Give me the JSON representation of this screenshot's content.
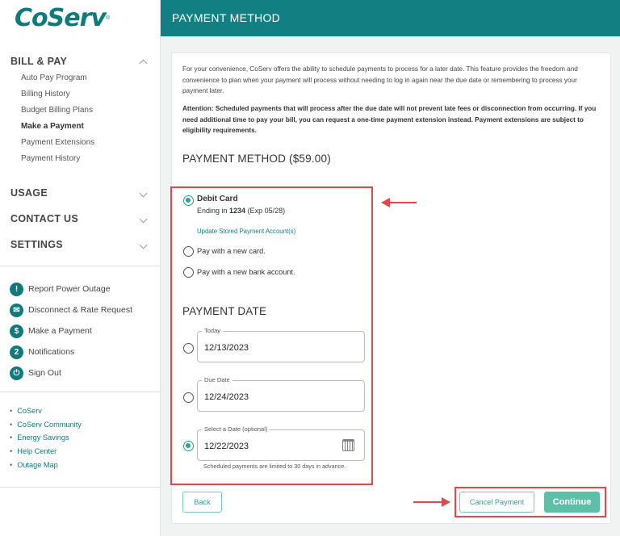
{
  "brand": {
    "logo_text": "CoServ",
    "logo_mark": "®"
  },
  "header": {
    "title": "PAYMENT METHOD"
  },
  "sidebar": {
    "bill_pay": {
      "label": "BILL & PAY",
      "items": [
        {
          "label": "Auto Pay Program"
        },
        {
          "label": "Billing History"
        },
        {
          "label": "Budget Billing Plans"
        },
        {
          "label": "Make a Payment",
          "active": true
        },
        {
          "label": "Payment Extensions"
        },
        {
          "label": "Payment History"
        }
      ]
    },
    "sections": [
      {
        "label": "USAGE"
      },
      {
        "label": "CONTACT US"
      },
      {
        "label": "SETTINGS"
      }
    ],
    "quick_links": [
      {
        "label": "Report Power Outage",
        "icon": "exclamation-icon",
        "glyph": "!"
      },
      {
        "label": "Disconnect & Rate Request",
        "icon": "envelope-icon",
        "glyph": "✉"
      },
      {
        "label": "Make a Payment",
        "icon": "dollar-icon",
        "glyph": "$"
      },
      {
        "label": "Notifications",
        "icon": "notification-count-icon",
        "glyph": "2"
      },
      {
        "label": "Sign Out",
        "icon": "power-icon",
        "glyph": "⏻"
      }
    ],
    "footer_links": [
      {
        "label": "CoServ"
      },
      {
        "label": "CoServ Community"
      },
      {
        "label": "Energy Savings"
      },
      {
        "label": "Help Center"
      },
      {
        "label": "Outage Map"
      }
    ]
  },
  "main": {
    "intro": "For your convenience, CoServ offers the ability to schedule payments to process for a later date. This feature provides the freedom and convenience to plan when your payment will process without needing to log in again near the due date or remembering to process your payment later.",
    "attention": "Attention: Scheduled payments that will process after the due date will not prevent late fees or disconnection from occurring. If you need additional time to pay your bill, you can request a one-time payment extension instead. Payment extensions are subject to eligibility requirements.",
    "payment_method_title": "PAYMENT METHOD ($59.00)",
    "stored_card": {
      "title": "Debit Card",
      "ending_prefix": "Ending in ",
      "last4": "1234",
      "expiry": " (Exp 05/28)",
      "update_link": "Update Stored Payment Account(s)",
      "selected": true
    },
    "new_card": {
      "label": "Pay with a new card.",
      "selected": false
    },
    "new_bank": {
      "label": "Pay with a new bank account.",
      "selected": false
    },
    "payment_date_title": "PAYMENT DATE",
    "dates": [
      {
        "label": "Today",
        "value": "12/13/2023",
        "selected": false
      },
      {
        "label": "Due Date",
        "value": "12/24/2023",
        "selected": false
      },
      {
        "label": "Select a Date (optional)",
        "value": "12/22/2023",
        "selected": true
      }
    ],
    "date_hint": "Scheduled payments are limited to 30 days in advance.",
    "buttons": {
      "back": "Back",
      "cancel": "Cancel Payment",
      "continue": "Continue"
    }
  },
  "colors": {
    "teal": "#128083",
    "accent_green": "#2aa58e",
    "annotation_red": "#e0484e"
  }
}
